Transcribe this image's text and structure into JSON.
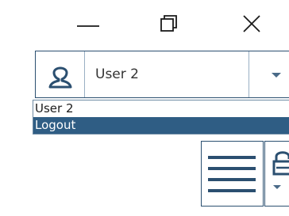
{
  "window_controls": {
    "minimize_icon": "minimize-icon",
    "maximize_icon": "restore-icon",
    "close_icon": "close-icon"
  },
  "user_selector": {
    "icon": "user-icon",
    "selected_value": "User 2",
    "dropdown_icon": "chevron-down-icon"
  },
  "dropdown": {
    "items": [
      {
        "label": "User 2",
        "selected": false
      },
      {
        "label": "Logout",
        "selected": true
      }
    ]
  },
  "toolbar": {
    "menu_icon": "hamburger-menu-icon",
    "lock_icon": "lock-icon",
    "lock_dropdown_icon": "chevron-down-icon"
  },
  "colors": {
    "accent": "#2b4f70",
    "selection": "#2f5d84",
    "border_light": "#9ab0c4",
    "text": "#333333"
  }
}
